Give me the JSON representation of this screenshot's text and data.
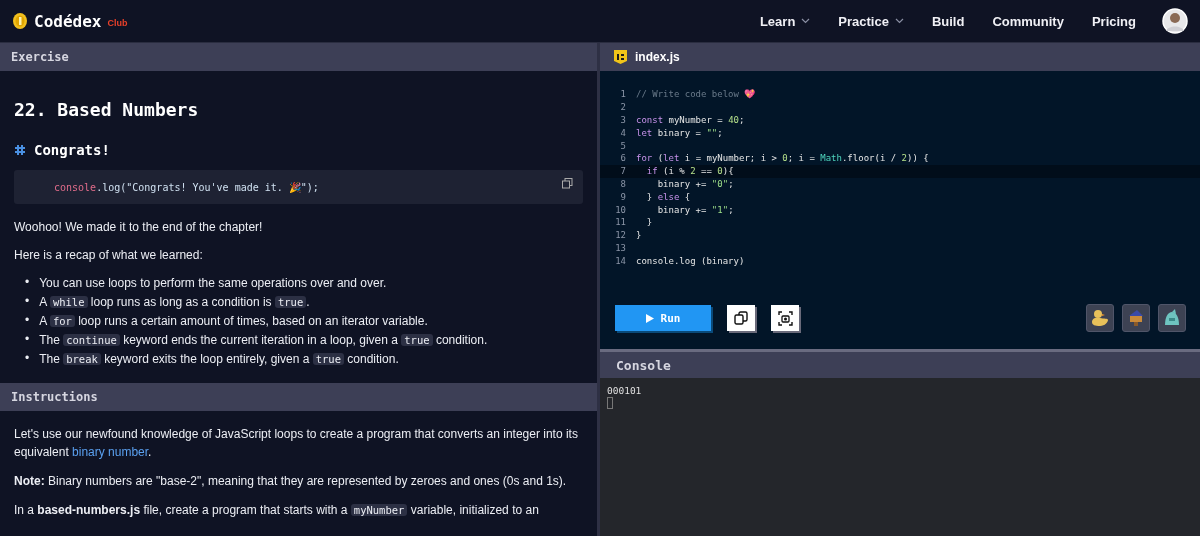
{
  "navbar": {
    "logo": "Codédex",
    "logo_badge": "Club",
    "links": [
      {
        "label": "Learn",
        "dropdown": true
      },
      {
        "label": "Practice",
        "dropdown": true
      },
      {
        "label": "Build",
        "dropdown": false
      },
      {
        "label": "Community",
        "dropdown": false
      },
      {
        "label": "Pricing",
        "dropdown": false
      }
    ]
  },
  "exercise": {
    "header": "Exercise",
    "title": "22. Based Numbers",
    "section": "Congrats!",
    "snippet": [
      {
        "kind": "func",
        "text": "console"
      },
      {
        "kind": "plain",
        "text": ".log(\"Congrats! You've made it. 🎉\");"
      }
    ],
    "paragraphs": [
      [
        {
          "kind": "text",
          "text": "Woohoo! We made it to the end of the chapter!"
        }
      ],
      [
        {
          "kind": "text",
          "text": "Here is a recap of what we learned:"
        }
      ]
    ],
    "bullets": [
      {
        "marker": "•",
        "segments": [
          {
            "kind": "text",
            "text": "You can use loops to perform the same operations over and over."
          }
        ]
      },
      {
        "marker": "•",
        "segments": [
          {
            "kind": "text",
            "text": "A "
          },
          {
            "kind": "code",
            "text": "while"
          },
          {
            "kind": "text",
            "text": " loop runs as long as a condition is "
          },
          {
            "kind": "code",
            "text": "true"
          },
          {
            "kind": "text",
            "text": "."
          }
        ]
      },
      {
        "marker": "•",
        "segments": [
          {
            "kind": "text",
            "text": "A "
          },
          {
            "kind": "code",
            "text": "for"
          },
          {
            "kind": "text",
            "text": " loop runs a certain amount of times, based on an iterator variable."
          }
        ]
      },
      {
        "marker": "•",
        "segments": [
          {
            "kind": "text",
            "text": "The "
          },
          {
            "kind": "code",
            "text": "continue"
          },
          {
            "kind": "text",
            "text": " keyword ends the current iteration in a loop, given a "
          },
          {
            "kind": "code",
            "text": "true"
          },
          {
            "kind": "text",
            "text": " condition."
          }
        ]
      },
      {
        "marker": "•",
        "segments": [
          {
            "kind": "text",
            "text": "The "
          },
          {
            "kind": "code",
            "text": "break"
          },
          {
            "kind": "text",
            "text": " keyword exits the loop entirely, given a "
          },
          {
            "kind": "code",
            "text": "true"
          },
          {
            "kind": "text",
            "text": " condition."
          }
        ]
      }
    ]
  },
  "instructions": {
    "header": "Instructions",
    "paragraphs": [
      [
        {
          "kind": "text",
          "text": "Let's use our newfound knowledge of JavaScript loops to create a program that converts an integer into its equivalent "
        },
        {
          "kind": "link",
          "text": "binary number"
        },
        {
          "kind": "text",
          "text": "."
        }
      ],
      [
        {
          "kind": "bold",
          "text": "Note:"
        },
        {
          "kind": "text",
          "text": " Binary numbers are \"base-2\", meaning that they are represented by zeroes and ones (0s and 1s)."
        }
      ],
      [
        {
          "kind": "text",
          "text": "In a "
        },
        {
          "kind": "bold",
          "text": "based-numbers.js"
        },
        {
          "kind": "text",
          "text": " file, create a program that starts with a "
        },
        {
          "kind": "code",
          "text": "myNumber"
        },
        {
          "kind": "text",
          "text": " variable, initialized to an"
        }
      ]
    ]
  },
  "editor": {
    "filename": "index.js",
    "lines": [
      {
        "number": "1",
        "active": false,
        "tokens": [
          {
            "kind": "comment",
            "text": "// Write code below 💖"
          }
        ]
      },
      {
        "number": "2",
        "active": false
      },
      {
        "number": "3",
        "active": false,
        "tokens": [
          {
            "kind": "keyword",
            "text": "const"
          },
          {
            "kind": "plain",
            "text": " myNumber = "
          },
          {
            "kind": "number",
            "text": "40"
          },
          {
            "kind": "plain",
            "text": ";"
          }
        ]
      },
      {
        "number": "4",
        "active": false,
        "tokens": [
          {
            "kind": "keyword",
            "text": "let"
          },
          {
            "kind": "plain",
            "text": " binary = "
          },
          {
            "kind": "string",
            "text": "\"\""
          },
          {
            "kind": "plain",
            "text": ";"
          }
        ]
      },
      {
        "number": "5",
        "active": false
      },
      {
        "number": "6",
        "active": false,
        "tokens": [
          {
            "kind": "keyword",
            "text": "for"
          },
          {
            "kind": "plain",
            "text": " ("
          },
          {
            "kind": "keyword",
            "text": "let"
          },
          {
            "kind": "plain",
            "text": " i = myNumber; i > "
          },
          {
            "kind": "number",
            "text": "0"
          },
          {
            "kind": "plain",
            "text": "; i = "
          },
          {
            "kind": "func",
            "text": "Math"
          },
          {
            "kind": "plain",
            "text": ".floor(i / "
          },
          {
            "kind": "number",
            "text": "2"
          },
          {
            "kind": "plain",
            "text": ")) {"
          }
        ]
      },
      {
        "number": "7",
        "active": true,
        "tokens": [
          {
            "kind": "keyword",
            "text": "  if"
          },
          {
            "kind": "plain",
            "text": " (i % "
          },
          {
            "kind": "number",
            "text": "2"
          },
          {
            "kind": "plain",
            "text": " == "
          },
          {
            "kind": "number",
            "text": "0"
          },
          {
            "kind": "plain",
            "text": "){"
          }
        ]
      },
      {
        "number": "8",
        "active": false,
        "tokens": [
          {
            "kind": "plain",
            "text": "    binary += "
          },
          {
            "kind": "string",
            "text": "\"0\""
          },
          {
            "kind": "plain",
            "text": ";"
          }
        ]
      },
      {
        "number": "9",
        "active": false,
        "tokens": [
          {
            "kind": "plain",
            "text": "  } "
          },
          {
            "kind": "keyword",
            "text": "else"
          },
          {
            "kind": "plain",
            "text": " {"
          }
        ]
      },
      {
        "number": "10",
        "active": false,
        "tokens": [
          {
            "kind": "plain",
            "text": "    binary += "
          },
          {
            "kind": "string",
            "text": "\"1\""
          },
          {
            "kind": "plain",
            "text": ";"
          }
        ]
      },
      {
        "number": "11",
        "active": false,
        "tokens": [
          {
            "kind": "plain",
            "text": "  }"
          }
        ]
      },
      {
        "number": "12",
        "active": false,
        "tokens": [
          {
            "kind": "plain",
            "text": "}"
          }
        ]
      },
      {
        "number": "13",
        "active": false
      },
      {
        "number": "14",
        "active": false,
        "tokens": [
          {
            "kind": "plain",
            "text": "console.log (binary)"
          }
        ]
      }
    ],
    "run_button": "Run"
  },
  "console": {
    "header": "Console",
    "output": "000101"
  }
}
